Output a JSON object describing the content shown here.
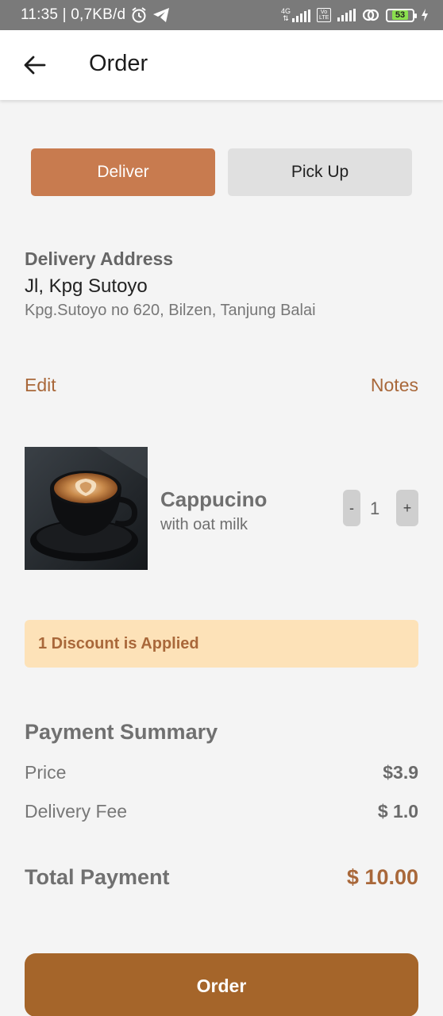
{
  "status_bar": {
    "time_info": "11:35 | 0,7KB/d",
    "network_label": "4G",
    "volte_label": "Vo LTE",
    "battery": "53"
  },
  "header": {
    "title": "Order"
  },
  "mode_toggle": {
    "deliver_label": "Deliver",
    "pickup_label": "Pick Up",
    "selected": "Deliver",
    "selected_color": "#c87b4f"
  },
  "address": {
    "heading": "Delivery Address",
    "name": "Jl, Kpg Sutoyo",
    "detail": "Kpg.Sutoyo no 620, Bilzen, Tanjung Balai",
    "edit_label": "Edit",
    "notes_label": "Notes"
  },
  "item": {
    "name": "Cappucino",
    "description": "with oat milk",
    "quantity": "1",
    "minus_label": "-",
    "plus_label": "+"
  },
  "discount": {
    "text": "1 Discount is Applied"
  },
  "summary": {
    "heading": "Payment Summary",
    "rows": [
      {
        "label": "Price",
        "value": "$3.9"
      },
      {
        "label": "Delivery Fee",
        "value": "$ 1.0"
      }
    ],
    "total_label": "Total Payment",
    "total_value": "$ 10.00"
  },
  "actions": {
    "order_label": "Order"
  },
  "colors": {
    "accent": "#a5652a",
    "discount_bg": "#fde2b8"
  }
}
